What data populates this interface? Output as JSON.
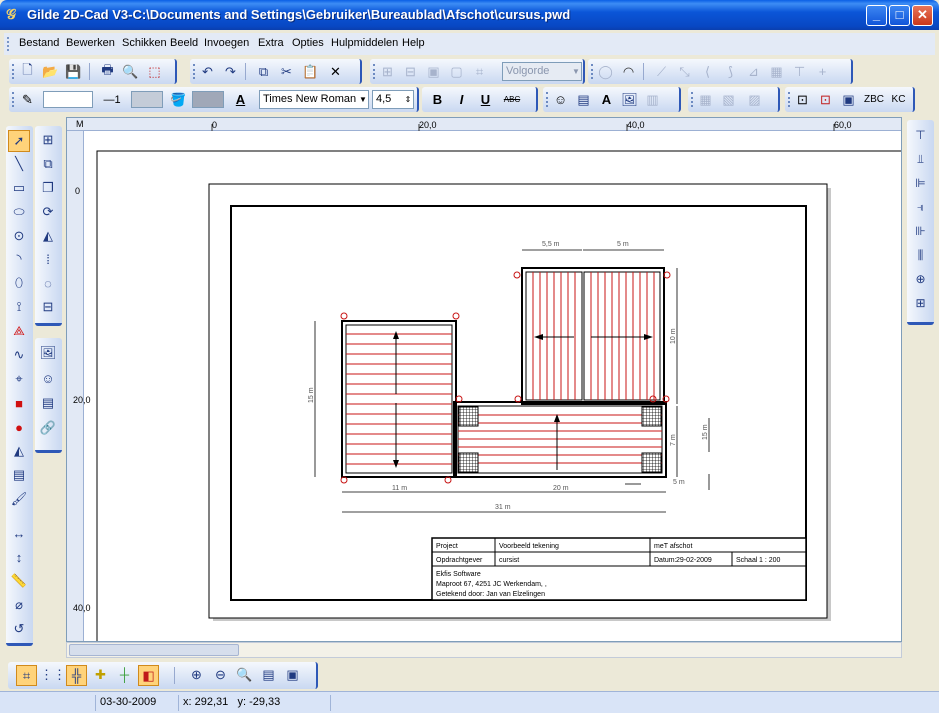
{
  "window": {
    "title": "Gilde 2D-Cad V3-C:\\Documents and Settings\\Gebruiker\\Bureaublad\\Afschot\\cursus.pwd",
    "minimize": "_",
    "maximize": "□",
    "close": "✕"
  },
  "menu": [
    "Bestand",
    "Bewerken",
    "Schikken",
    "Beeld",
    "Invoegen",
    "Extra",
    "Opties",
    "Hulpmiddelen",
    "Help"
  ],
  "toolbar": {
    "order_label": "Volgorde",
    "line_width": "1",
    "font_name": "Times New Roman",
    "font_size": "4,5",
    "bold": "B",
    "italic": "I",
    "underline": "U",
    "strike": "ABC",
    "font_color_glyph": "A",
    "zbc": "ZBC",
    "kc": "KC"
  },
  "ruler": {
    "origin": "M",
    "h_ticks": [
      "0",
      "20,0",
      "40,0",
      "60,0"
    ],
    "v_ticks": [
      "0",
      "20,0",
      "40,0"
    ]
  },
  "drawing": {
    "dims": {
      "top_left": "5,5 m",
      "top_right": "5 m",
      "left": "15 m",
      "bottom_left": "11 m",
      "bottom_right": "20 m",
      "bottom_total": "31 m",
      "right_upper": "10 m",
      "right_lower": "7 m",
      "right_far": "15 m",
      "right_small": "5 m"
    },
    "title_block": {
      "project_label": "Project",
      "project_value": "Voorbeeld tekening",
      "type_value": "meT afschot",
      "client_label": "Opdrachtgever",
      "client_value": "cursist",
      "date_label": "Datum:",
      "date_value": "29-02-2009",
      "scale_label": "Schaal",
      "scale_value": "1 : 200",
      "company": "Ekfis Software",
      "address": "Maproot 67, 4251 JC Werkendam, ,",
      "drawn_by": "Getekend door: Jan van Elzelingen"
    }
  },
  "status": {
    "date": "03-30-2009",
    "x_label": "x:",
    "x_value": "292,31",
    "y_label": "y:",
    "y_value": "-29,33"
  },
  "colors": {
    "titlebar": "#0A52D6",
    "accent": "#2E58B7",
    "hatch_red": "#C81414",
    "highlight": "#FFD37A"
  }
}
